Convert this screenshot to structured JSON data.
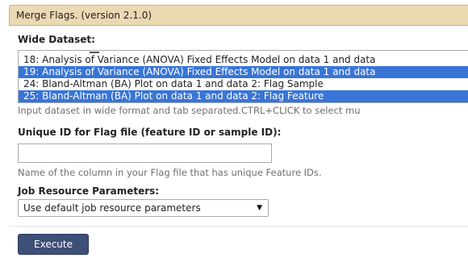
{
  "tool": {
    "title": "Merge Flags. (version 2.1.0)"
  },
  "wide_dataset": {
    "label": "Wide Dataset:",
    "options": [
      {
        "label": "18: Analysis of Variance (ANOVA) Fixed Effects Model on data 1 and data",
        "selected": false
      },
      {
        "label": "19: Analysis of Variance (ANOVA) Fixed Effects Model on data 1 and data",
        "selected": true
      },
      {
        "label": "24: Bland-Altman (BA) Plot on data 1 and data 2: Flag Sample",
        "selected": false
      },
      {
        "label": "25: Bland-Altman (BA) Plot on data 1 and data 2: Flag Feature",
        "selected": true
      }
    ],
    "help": "Input dataset in wide format and tab separated.CTRL+CLICK to select mu"
  },
  "unique_id": {
    "label": "Unique ID for Flag file (feature ID or sample ID):",
    "value": "",
    "help": "Name of the column in your Flag file that has unique Feature IDs."
  },
  "job_resources": {
    "label": "Job Resource Parameters:",
    "selected": "Use default job resource parameters"
  },
  "actions": {
    "execute_label": "Execute"
  },
  "colors": {
    "header_bg": "#ebd9b2",
    "selection": "#3875d7",
    "execute_bg": "#3e4f78"
  }
}
